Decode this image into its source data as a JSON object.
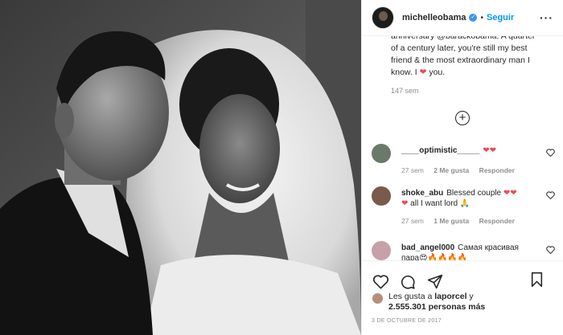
{
  "header": {
    "username": "michelleobama",
    "verified_glyph": "✓",
    "separator": "•",
    "follow_label": "Seguir",
    "more_glyph": "···"
  },
  "caption": {
    "line1": "anniversary @barackobama. A quarter",
    "line2": "of a century later, you're still my best",
    "line3": "friend & the most extraordinary man I",
    "line4_pre": "know. I ",
    "line4_heart": "❤",
    "line4_post": " you.",
    "age": "147 sem"
  },
  "load_more": {
    "glyph": "+"
  },
  "comments": [
    {
      "user": "____optimistic_____",
      "text": "",
      "emoji": "❤❤",
      "age": "27 sem",
      "likes": "2 Me gusta",
      "reply": "Responder",
      "avatar_color": "#6a7a6a"
    },
    {
      "user": "shoke_abu",
      "text": "Blessed couple",
      "emoji": "❤❤",
      "text2_pre": "❤",
      "text2": " all I want lord ",
      "text2_emoji": "🙏",
      "age": "27 sem",
      "likes": "1 Me gusta",
      "reply": "Responder",
      "avatar_color": "#7a5a4a"
    },
    {
      "user": "bad_angel000",
      "text": "Самая красивая",
      "text2": "пара",
      "text2_emoji": "😍🔥🔥🔥🔥",
      "avatar_color": "#c8a0a8"
    }
  ],
  "likes": {
    "prefix": "Les gusta a ",
    "user": "laporcel",
    "mid": " y",
    "count": "2.555.301 personas más"
  },
  "date": "3 DE OCTUBRE DE 2017",
  "colors": {
    "accent": "#0095f6",
    "verified": "#3897f0",
    "heart": "#ed4956",
    "meta": "#8e8e8e"
  },
  "icons": [
    "heart-icon",
    "comment-icon",
    "share-icon",
    "bookmark-icon",
    "add-circle-icon"
  ]
}
